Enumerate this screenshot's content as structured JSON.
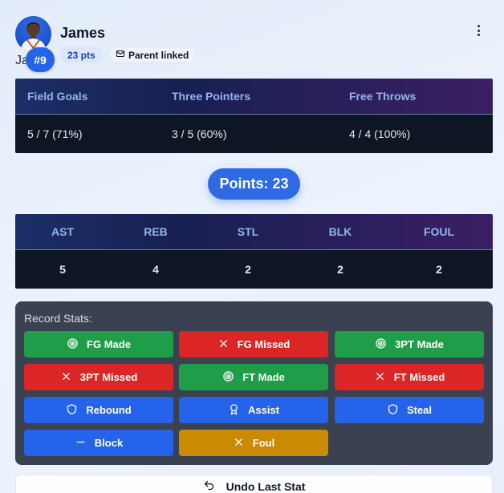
{
  "player": {
    "name": "James",
    "initials": "Ja",
    "jersey": "#9",
    "points_badge": "23 pts",
    "parent_badge": "Parent linked"
  },
  "shooting": {
    "headers": [
      "Field Goals",
      "Three Pointers",
      "Free Throws"
    ],
    "values": [
      "5 / 7 (71%)",
      "3 / 5 (60%)",
      "4 / 4 (100%)"
    ]
  },
  "points_total": "Points: 23",
  "box": {
    "headers": [
      "AST",
      "REB",
      "STL",
      "BLK",
      "FOUL"
    ],
    "values": [
      "5",
      "4",
      "2",
      "2",
      "2"
    ]
  },
  "record": {
    "title": "Record Stats:",
    "buttons": [
      {
        "label": "FG Made",
        "icon": "target-icon",
        "color": "#1f9d48"
      },
      {
        "label": "FG Missed",
        "icon": "x-icon",
        "color": "#dc2626"
      },
      {
        "label": "3PT Made",
        "icon": "target-icon",
        "color": "#1f9d48"
      },
      {
        "label": "3PT Missed",
        "icon": "x-icon",
        "color": "#dc2626"
      },
      {
        "label": "FT Made",
        "icon": "target-icon",
        "color": "#1f9d48"
      },
      {
        "label": "FT Missed",
        "icon": "x-icon",
        "color": "#dc2626"
      },
      {
        "label": "Rebound",
        "icon": "shield-icon",
        "color": "#2563eb"
      },
      {
        "label": "Assist",
        "icon": "award-icon",
        "color": "#2563eb"
      },
      {
        "label": "Steal",
        "icon": "shield-icon",
        "color": "#2563eb"
      },
      {
        "label": "Block",
        "icon": "minus-icon",
        "color": "#2563eb"
      },
      {
        "label": "Foul",
        "icon": "x-icon",
        "color": "#ca8a04"
      }
    ]
  },
  "undo_label": "Undo Last Stat",
  "colors": {
    "accent": "#2563eb",
    "success": "#1f9d48",
    "danger": "#dc2626",
    "warning": "#ca8a04",
    "panel": "#3a4150"
  }
}
